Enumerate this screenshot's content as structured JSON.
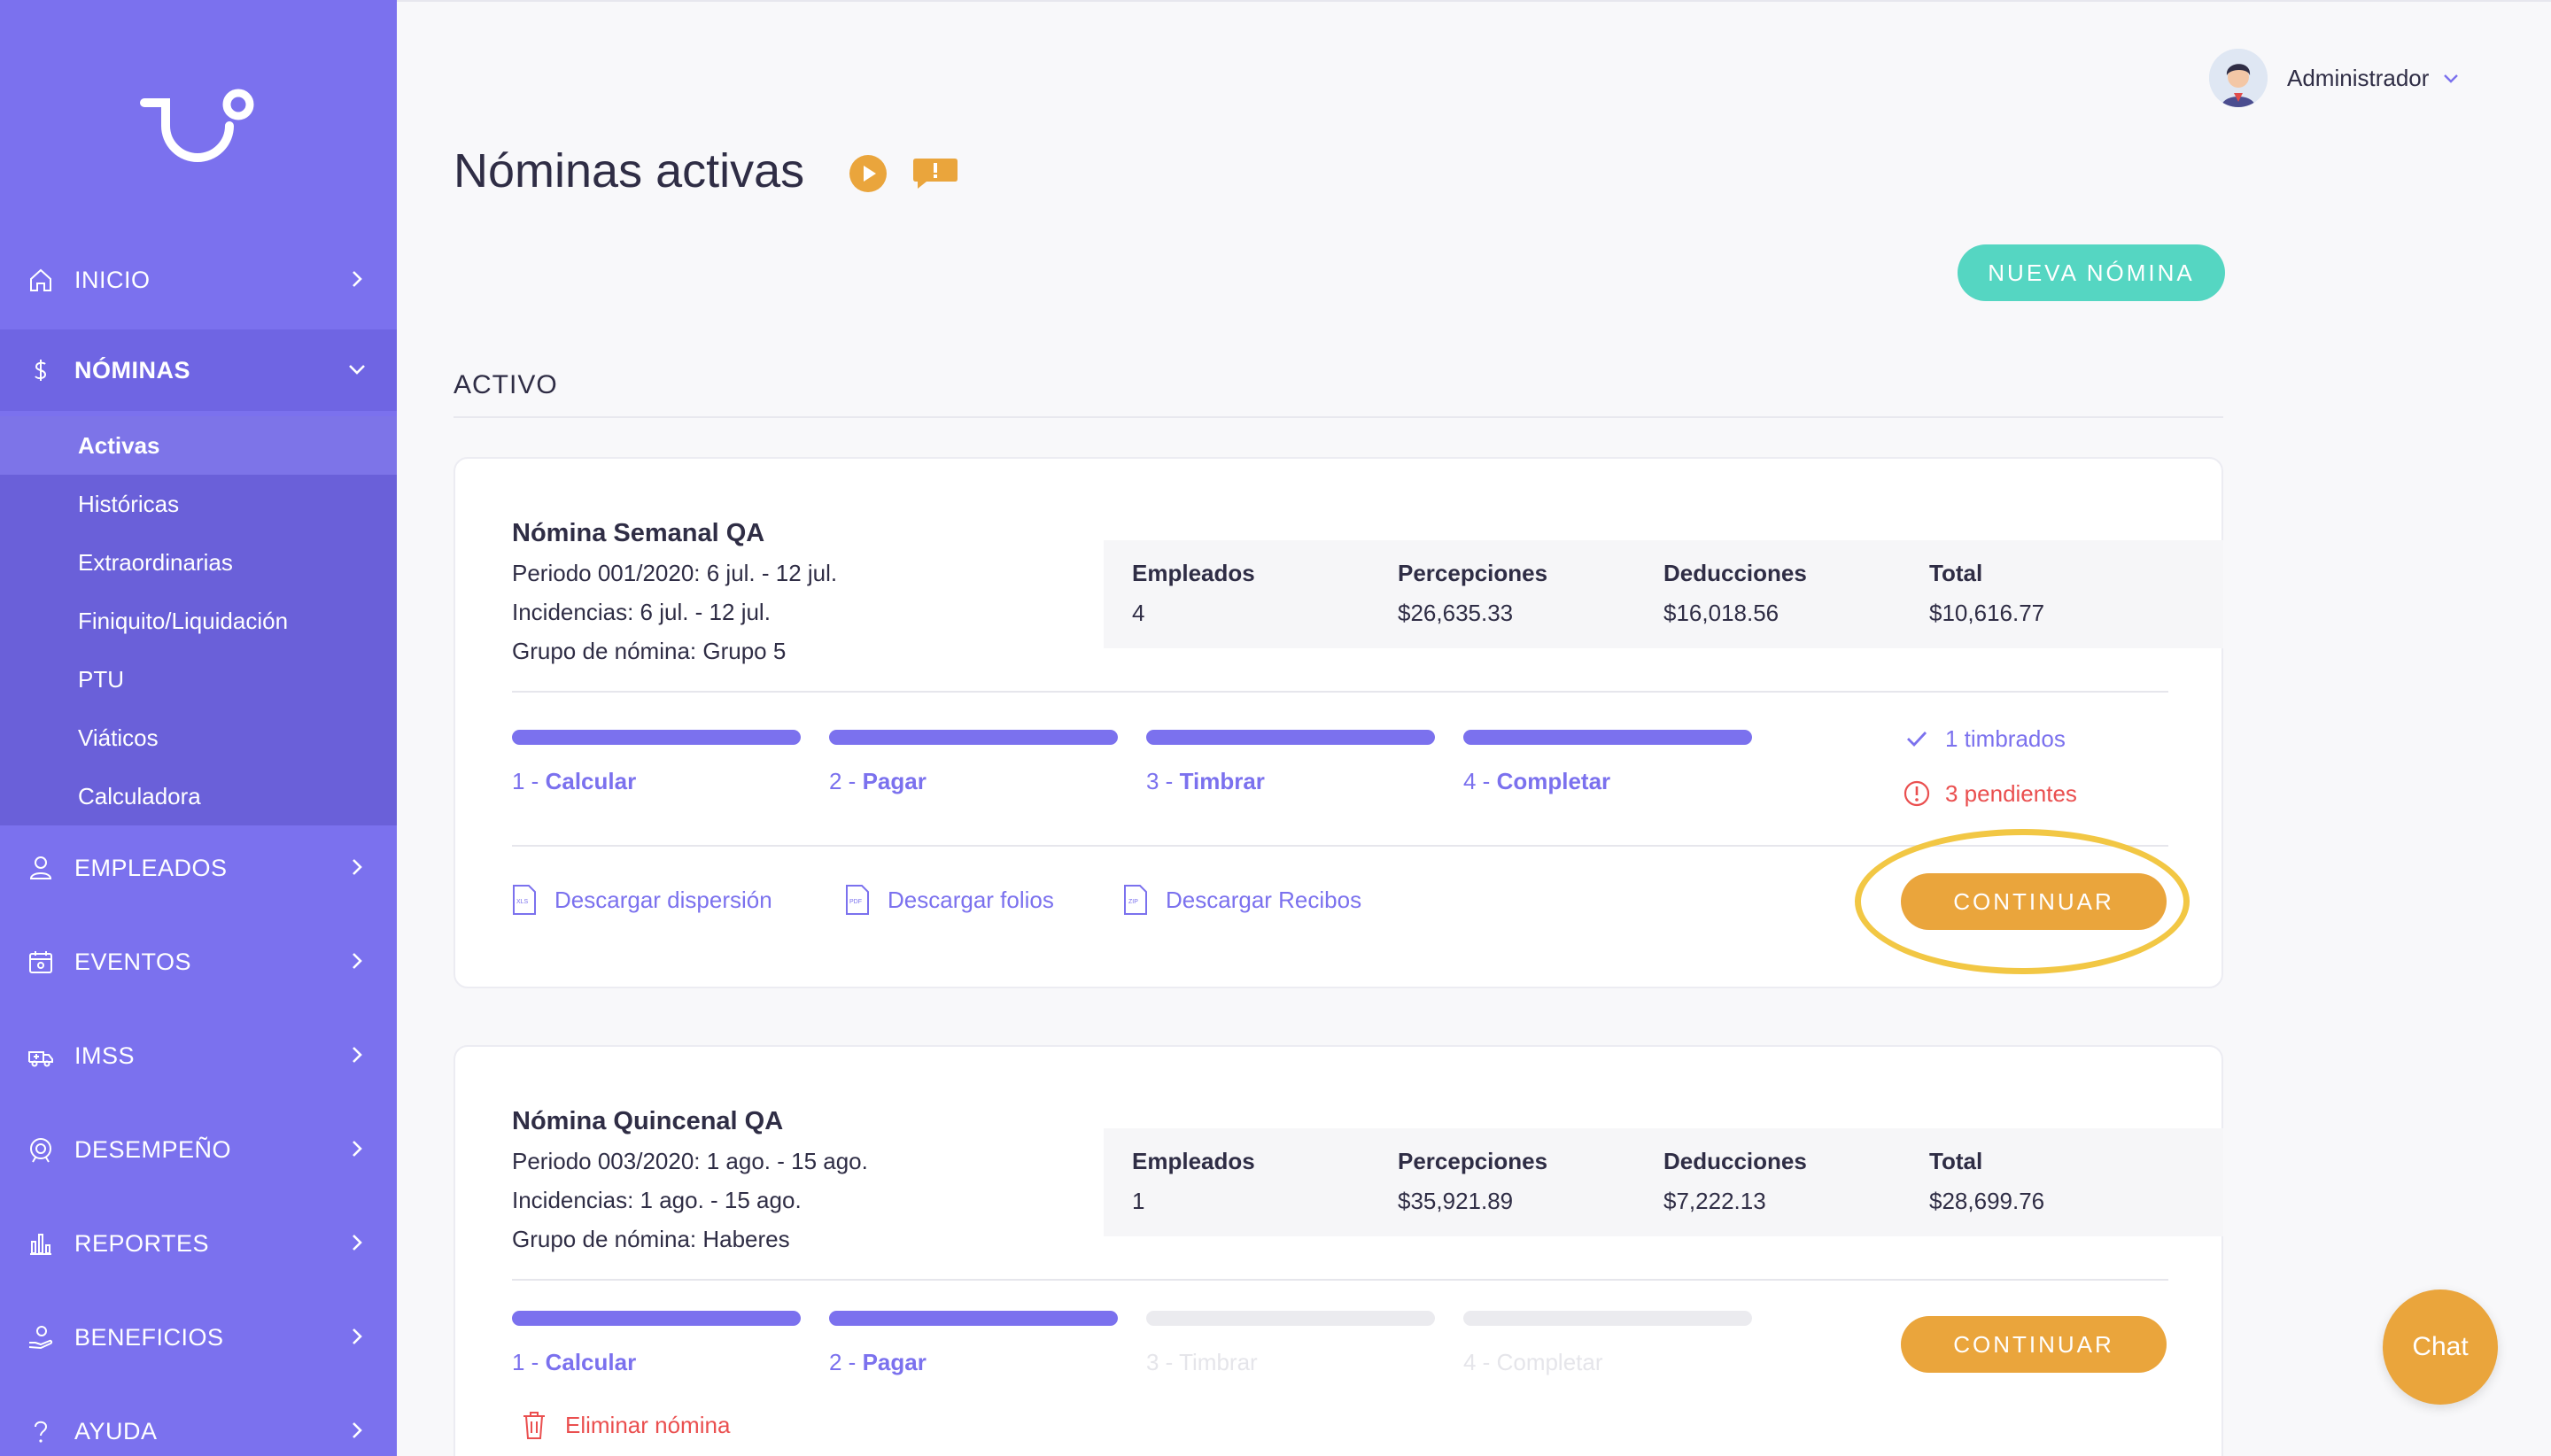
{
  "sidebar": {
    "items": [
      {
        "label": "INICIO",
        "icon": "home-icon"
      },
      {
        "label": "NÓMINAS",
        "icon": "dollar-icon"
      },
      {
        "label": "EMPLEADOS",
        "icon": "user-icon"
      },
      {
        "label": "EVENTOS",
        "icon": "calendar-icon"
      },
      {
        "label": "IMSS",
        "icon": "ambulance-icon"
      },
      {
        "label": "DESEMPEÑO",
        "icon": "target-icon"
      },
      {
        "label": "REPORTES",
        "icon": "bar-chart-icon"
      },
      {
        "label": "BENEFICIOS",
        "icon": "hand-coin-icon"
      },
      {
        "label": "AYUDA",
        "icon": "question-icon"
      }
    ],
    "nominas_submenu": [
      "Activas",
      "Históricas",
      "Extraordinarias",
      "Finiquito/Liquidación",
      "PTU",
      "Viáticos",
      "Calculadora"
    ],
    "active_subitem": "Activas"
  },
  "header": {
    "user_name": "Administrador",
    "page_title": "Nóminas activas",
    "new_button": "NUEVA NÓMINA"
  },
  "section": {
    "label": "ACTIVO"
  },
  "cards": [
    {
      "title": "Nómina Semanal QA",
      "periodo": "Periodo 001/2020: 6 jul. - 12 jul.",
      "incidencias": "Incidencias: 6 jul. - 12 jul.",
      "grupo": "Grupo de nómina: Grupo 5",
      "stats": [
        {
          "label": "Empleados",
          "value": "4"
        },
        {
          "label": "Percepciones",
          "value": "$26,635.33"
        },
        {
          "label": "Deducciones",
          "value": "$16,018.56"
        },
        {
          "label": "Total",
          "value": "$10,616.77"
        }
      ],
      "steps": [
        {
          "num": "1 - ",
          "name": "Calcular",
          "done": true
        },
        {
          "num": "2 - ",
          "name": "Pagar",
          "done": true
        },
        {
          "num": "3 - ",
          "name": "Timbrar",
          "done": true
        },
        {
          "num": "4 - ",
          "name": "Completar",
          "done": true
        }
      ],
      "status_ok": "1 timbrados",
      "status_pending": "3 pendientes",
      "downloads": [
        "Descargar dispersión",
        "Descargar folios",
        "Descargar Recibos"
      ],
      "continue_label": "CONTINUAR"
    },
    {
      "title": "Nómina Quincenal QA",
      "periodo": "Periodo 003/2020: 1 ago. - 15 ago.",
      "incidencias": "Incidencias: 1 ago. - 15 ago.",
      "grupo": "Grupo de nómina: Haberes",
      "stats": [
        {
          "label": "Empleados",
          "value": "1"
        },
        {
          "label": "Percepciones",
          "value": "$35,921.89"
        },
        {
          "label": "Deducciones",
          "value": "$7,222.13"
        },
        {
          "label": "Total",
          "value": "$28,699.76"
        }
      ],
      "steps": [
        {
          "num": "1 - ",
          "name": "Calcular",
          "done": true
        },
        {
          "num": "2 - ",
          "name": "Pagar",
          "done": true
        },
        {
          "num": "3 - ",
          "name": "Timbrar",
          "done": false
        },
        {
          "num": "4 - ",
          "name": "Completar",
          "done": false
        }
      ],
      "delete_label": "Eliminar nómina",
      "continue_label": "CONTINUAR"
    }
  ],
  "chat": {
    "label": "Chat"
  },
  "colors": {
    "sidebar": "#7b71ee",
    "accent": "#7b71ee",
    "teal_button": "#55d6c2",
    "orange_button": "#eaa53c",
    "error": "#ea4f4f",
    "highlight": "#f2c744"
  }
}
